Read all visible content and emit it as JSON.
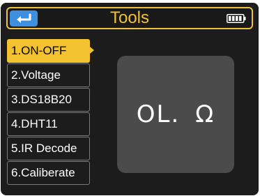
{
  "header": {
    "title": "Tools",
    "back_icon": "return-arrow-icon",
    "battery_icon": "battery-full-icon",
    "accent_color": "#f2c230",
    "back_color": "#3f8fe0"
  },
  "menu": {
    "selected_index": 0,
    "items": [
      {
        "label": "1.ON-OFF"
      },
      {
        "label": "2.Voltage"
      },
      {
        "label": "3.DS18B20"
      },
      {
        "label": "4.DHT11"
      },
      {
        "label": "5.IR Decode"
      },
      {
        "label": "6.Caliberate"
      }
    ]
  },
  "display": {
    "value": "OL.",
    "unit": "Ω"
  }
}
